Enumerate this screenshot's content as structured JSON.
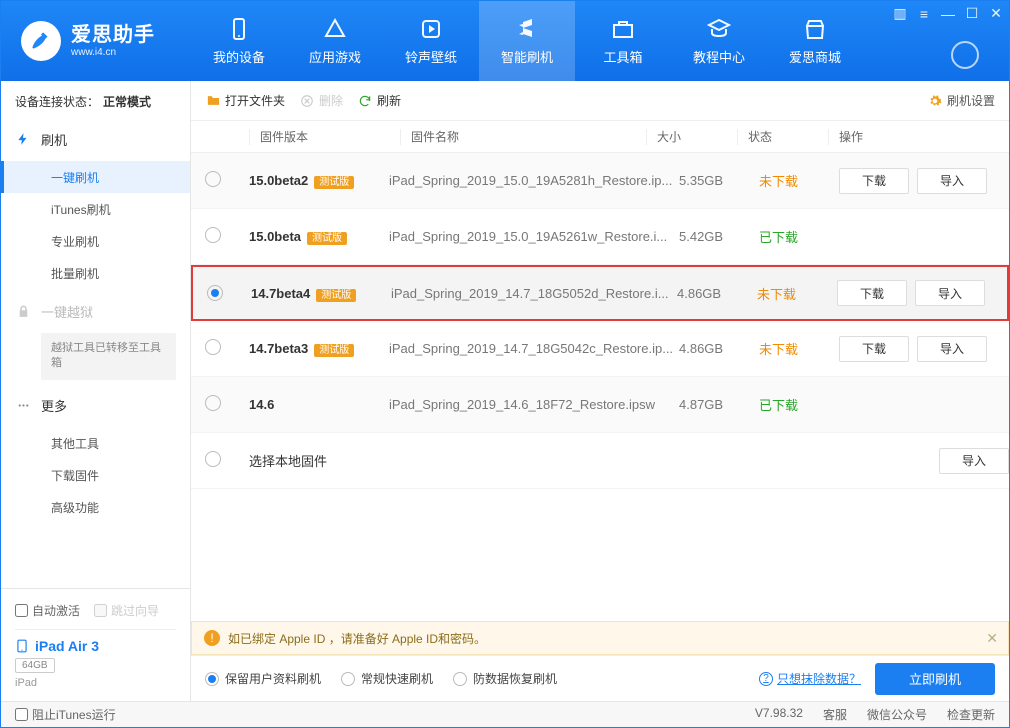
{
  "brand": {
    "title": "爱思助手",
    "sub": "www.i4.cn"
  },
  "nav": {
    "items": [
      {
        "label": "我的设备",
        "icon": "device-icon"
      },
      {
        "label": "应用游戏",
        "icon": "apps-icon"
      },
      {
        "label": "铃声壁纸",
        "icon": "ringtone-icon"
      },
      {
        "label": "智能刷机",
        "icon": "flash-icon",
        "active": true
      },
      {
        "label": "工具箱",
        "icon": "toolbox-icon"
      },
      {
        "label": "教程中心",
        "icon": "tutorial-icon"
      },
      {
        "label": "爱思商城",
        "icon": "store-icon"
      }
    ]
  },
  "sidebar": {
    "conn_label": "设备连接状态：",
    "conn_value": "正常模式",
    "groups": {
      "flash": {
        "label": "刷机",
        "items": [
          "一键刷机",
          "iTunes刷机",
          "专业刷机",
          "批量刷机"
        ],
        "activeIndex": 0
      },
      "jailbreak": {
        "label": "一键越狱",
        "note": "越狱工具已转移至工具箱"
      },
      "more": {
        "label": "更多",
        "items": [
          "其他工具",
          "下载固件",
          "高级功能"
        ]
      }
    },
    "auto_activate": "自动激活",
    "skip_guide": "跳过向导",
    "device": {
      "name": "iPad Air 3",
      "badge": "64GB",
      "sub": "iPad"
    }
  },
  "toolbar": {
    "open_folder": "打开文件夹",
    "delete": "删除",
    "refresh": "刷新",
    "settings": "刷机设置"
  },
  "table": {
    "headers": {
      "version": "固件版本",
      "name": "固件名称",
      "size": "大小",
      "status": "状态",
      "ops": "操作"
    },
    "beta_badge": "测试版",
    "op_download": "下载",
    "op_import": "导入",
    "local_row_label": "选择本地固件",
    "rows": [
      {
        "version": "15.0beta2",
        "beta": true,
        "name": "iPad_Spring_2019_15.0_19A5281h_Restore.ip...",
        "size": "5.35GB",
        "status": "未下载",
        "status_cls": "orange",
        "selected": false,
        "has_download": true
      },
      {
        "version": "15.0beta",
        "beta": true,
        "name": "iPad_Spring_2019_15.0_19A5261w_Restore.i...",
        "size": "5.42GB",
        "status": "已下载",
        "status_cls": "green",
        "selected": false,
        "has_download": false
      },
      {
        "version": "14.7beta4",
        "beta": true,
        "name": "iPad_Spring_2019_14.7_18G5052d_Restore.i...",
        "size": "4.86GB",
        "status": "未下载",
        "status_cls": "orange",
        "selected": true,
        "highlight": true,
        "has_download": true
      },
      {
        "version": "14.7beta3",
        "beta": true,
        "name": "iPad_Spring_2019_14.7_18G5042c_Restore.ip...",
        "size": "4.86GB",
        "status": "未下载",
        "status_cls": "orange",
        "selected": false,
        "has_download": true
      },
      {
        "version": "14.6",
        "beta": false,
        "name": "iPad_Spring_2019_14.6_18F72_Restore.ipsw",
        "size": "4.87GB",
        "status": "已下载",
        "status_cls": "green",
        "selected": false,
        "has_download": false
      }
    ]
  },
  "warning": "如已绑定 Apple ID ，请准备好 Apple ID和密码。",
  "action_bar": {
    "options": [
      "保留用户资料刷机",
      "常规快速刷机",
      "防数据恢复刷机"
    ],
    "selected": 0,
    "link": "只想抹除数据？",
    "primary": "立即刷机"
  },
  "footer": {
    "block_itunes": "阻止iTunes运行",
    "version": "V7.98.32",
    "links": [
      "客服",
      "微信公众号",
      "检查更新"
    ]
  }
}
